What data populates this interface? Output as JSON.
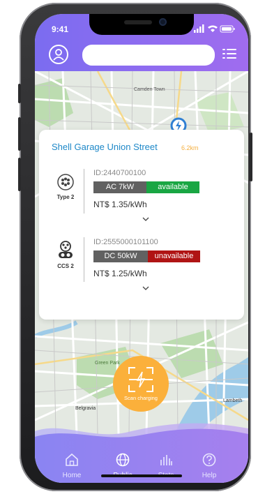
{
  "status_bar": {
    "time": "9:41"
  },
  "header": {
    "search_placeholder": ""
  },
  "map": {
    "labels": [
      "Camden Town",
      "Green Park",
      "Belgravia",
      "Lambeth"
    ]
  },
  "station": {
    "name": "Shell Garage Union Street",
    "distance": "6.2km",
    "connectors": [
      {
        "type": "Type 2",
        "id": "ID:2440700100",
        "power": "AC 7kW",
        "status": "available",
        "status_color": "#19a643",
        "price": "NT$ 1.35/kWh"
      },
      {
        "type": "CCS 2",
        "id": "ID:2555000101100",
        "power": "DC 50kW",
        "status": "unavailable",
        "status_color": "#b01414",
        "price": "NT$ 1.25/kWh"
      }
    ]
  },
  "scan_button": {
    "label": "Scan charging"
  },
  "bottom_nav": {
    "items": [
      {
        "label": "Home",
        "icon": "home-icon"
      },
      {
        "label": "Public",
        "icon": "globe-icon"
      },
      {
        "label": "Stats",
        "icon": "bar-chart-icon"
      },
      {
        "label": "Help",
        "icon": "question-icon"
      }
    ]
  },
  "colors": {
    "header_start": "#7b6cf0",
    "header_end": "#a06cef",
    "accent": "#1e88c8",
    "scan": "#fbb03b"
  }
}
